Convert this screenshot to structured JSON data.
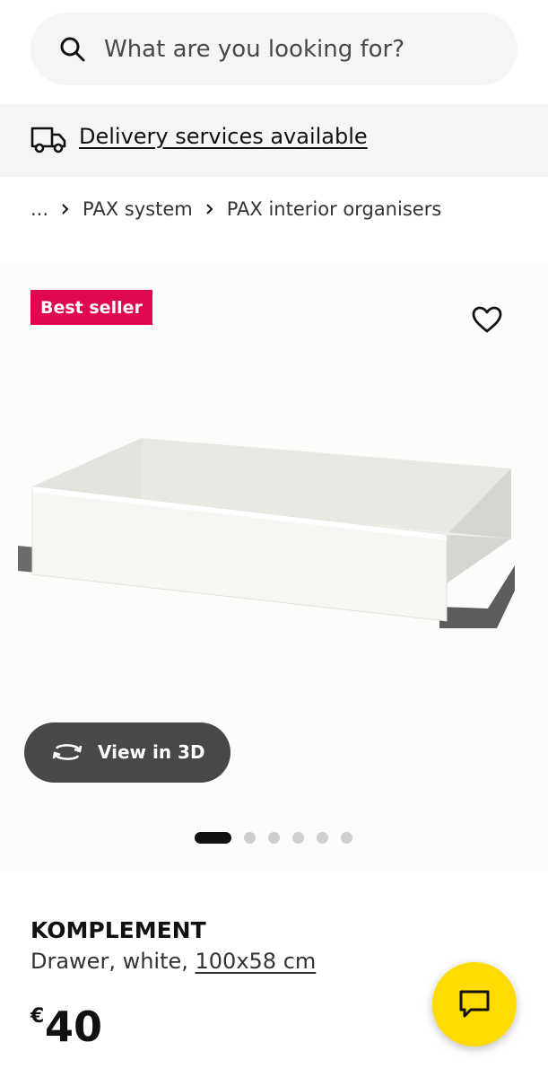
{
  "search": {
    "placeholder": "What are you looking for?"
  },
  "delivery": {
    "label": "Delivery services available"
  },
  "breadcrumb": {
    "items": [
      "...",
      "PAX system",
      "PAX interior organisers"
    ]
  },
  "media": {
    "badge": "Best seller",
    "view3d_label": "View in 3D",
    "carousel": {
      "total": 6,
      "active_index": 0
    }
  },
  "product": {
    "name": "KOMPLEMENT",
    "description": "Drawer, white, ",
    "size": "100x58 cm",
    "currency": "€",
    "price": "40"
  },
  "colors": {
    "badge": "#e00751",
    "chat_button": "#ffdb00",
    "view3d_button": "#484848",
    "banner_bg": "#f5f5f5"
  },
  "icons": [
    "search-icon",
    "truck-icon",
    "chevron-right-icon",
    "heart-icon",
    "rotate-3d-icon",
    "chat-icon"
  ]
}
